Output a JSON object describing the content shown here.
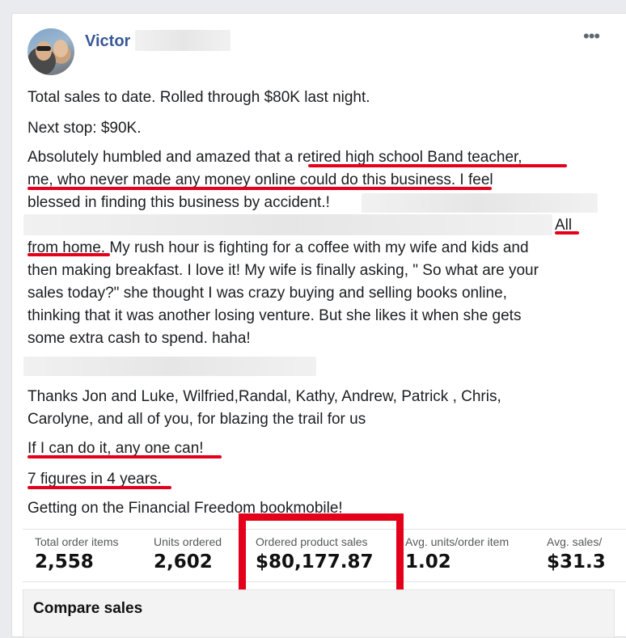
{
  "post": {
    "author": "Victor",
    "more_icon": "•••",
    "lines": [
      "Total sales to date. Rolled through $80K last night.",
      "Next stop: $90K.",
      "Absolutely humbled and amazed that a retired high school Band teacher,",
      "me, who never made any money online could do this business. I feel",
      "blessed in finding this business by accident.!",
      "All",
      "from home. My rush hour is fighting for a coffee with my wife and kids and",
      "then making breakfast. I love it! My wife is finally asking, \" So what are your",
      "sales today?\" she thought I was crazy buying and selling books online,",
      "thinking that it was another losing venture. But she likes it when she gets",
      "some extra cash to spend. haha!",
      "Thanks Jon and Luke, Wilfried,Randal, Kathy, Andrew, Patrick , Chris,",
      "Carolyne, and all of you, for blazing the trail for us",
      "If I can do it, any one can!",
      "7 figures in 4 years.",
      "Getting on the Financial Freedom bookmobile!"
    ]
  },
  "stats": [
    {
      "label": "Total order items",
      "value": "2,558"
    },
    {
      "label": "Units ordered",
      "value": "2,602"
    },
    {
      "label": "Ordered product sales",
      "value": "$80,177.87"
    },
    {
      "label": "Avg. units/order item",
      "value": "1.02"
    },
    {
      "label": "Avg. sales/",
      "value": "$31.3"
    }
  ],
  "compare": {
    "title": "Compare sales"
  },
  "colors": {
    "accent": "#e4001b",
    "author": "#385898"
  }
}
